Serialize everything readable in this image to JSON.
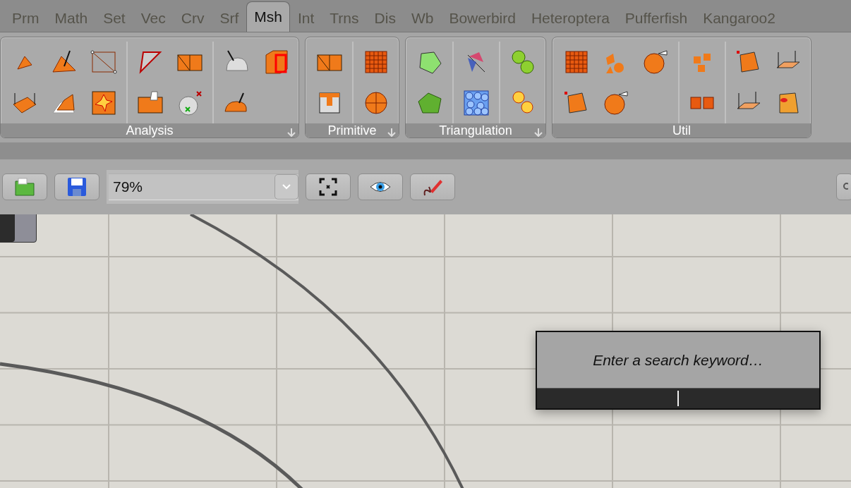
{
  "tabs": [
    {
      "label": "Prm",
      "selected": false
    },
    {
      "label": "Math",
      "selected": false
    },
    {
      "label": "Set",
      "selected": false
    },
    {
      "label": "Vec",
      "selected": false
    },
    {
      "label": "Crv",
      "selected": false
    },
    {
      "label": "Srf",
      "selected": false
    },
    {
      "label": "Msh",
      "selected": true
    },
    {
      "label": "Int",
      "selected": false
    },
    {
      "label": "Trns",
      "selected": false
    },
    {
      "label": "Dis",
      "selected": false
    },
    {
      "label": "Wb",
      "selected": false
    },
    {
      "label": "Bowerbird",
      "selected": false
    },
    {
      "label": "Heteroptera",
      "selected": false
    },
    {
      "label": "Pufferfish",
      "selected": false
    },
    {
      "label": "Kangaroo2",
      "selected": false
    }
  ],
  "panels": [
    {
      "title": "Analysis",
      "expandable": true
    },
    {
      "title": "Primitive",
      "expandable": true
    },
    {
      "title": "Triangulation",
      "expandable": true
    },
    {
      "title": "Util",
      "expandable": false
    }
  ],
  "toolbar": {
    "zoom": {
      "value": "79%"
    }
  },
  "search": {
    "prompt": "Enter a search keyword…"
  }
}
